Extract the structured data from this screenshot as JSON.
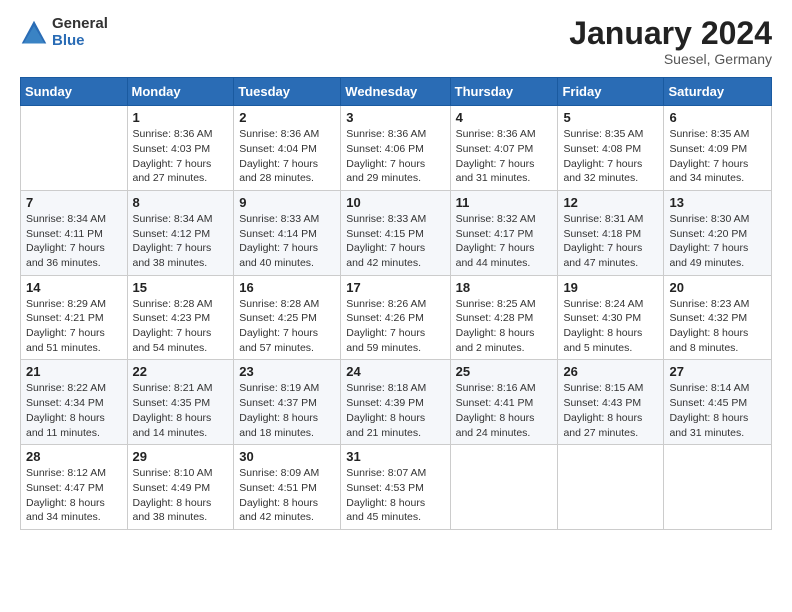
{
  "logo": {
    "general": "General",
    "blue": "Blue"
  },
  "header": {
    "month_title": "January 2024",
    "subtitle": "Suesel, Germany"
  },
  "weekdays": [
    "Sunday",
    "Monday",
    "Tuesday",
    "Wednesday",
    "Thursday",
    "Friday",
    "Saturday"
  ],
  "weeks": [
    [
      {
        "day": "",
        "info": ""
      },
      {
        "day": "1",
        "info": "Sunrise: 8:36 AM\nSunset: 4:03 PM\nDaylight: 7 hours\nand 27 minutes."
      },
      {
        "day": "2",
        "info": "Sunrise: 8:36 AM\nSunset: 4:04 PM\nDaylight: 7 hours\nand 28 minutes."
      },
      {
        "day": "3",
        "info": "Sunrise: 8:36 AM\nSunset: 4:06 PM\nDaylight: 7 hours\nand 29 minutes."
      },
      {
        "day": "4",
        "info": "Sunrise: 8:36 AM\nSunset: 4:07 PM\nDaylight: 7 hours\nand 31 minutes."
      },
      {
        "day": "5",
        "info": "Sunrise: 8:35 AM\nSunset: 4:08 PM\nDaylight: 7 hours\nand 32 minutes."
      },
      {
        "day": "6",
        "info": "Sunrise: 8:35 AM\nSunset: 4:09 PM\nDaylight: 7 hours\nand 34 minutes."
      }
    ],
    [
      {
        "day": "7",
        "info": "Sunrise: 8:34 AM\nSunset: 4:11 PM\nDaylight: 7 hours\nand 36 minutes."
      },
      {
        "day": "8",
        "info": "Sunrise: 8:34 AM\nSunset: 4:12 PM\nDaylight: 7 hours\nand 38 minutes."
      },
      {
        "day": "9",
        "info": "Sunrise: 8:33 AM\nSunset: 4:14 PM\nDaylight: 7 hours\nand 40 minutes."
      },
      {
        "day": "10",
        "info": "Sunrise: 8:33 AM\nSunset: 4:15 PM\nDaylight: 7 hours\nand 42 minutes."
      },
      {
        "day": "11",
        "info": "Sunrise: 8:32 AM\nSunset: 4:17 PM\nDaylight: 7 hours\nand 44 minutes."
      },
      {
        "day": "12",
        "info": "Sunrise: 8:31 AM\nSunset: 4:18 PM\nDaylight: 7 hours\nand 47 minutes."
      },
      {
        "day": "13",
        "info": "Sunrise: 8:30 AM\nSunset: 4:20 PM\nDaylight: 7 hours\nand 49 minutes."
      }
    ],
    [
      {
        "day": "14",
        "info": "Sunrise: 8:29 AM\nSunset: 4:21 PM\nDaylight: 7 hours\nand 51 minutes."
      },
      {
        "day": "15",
        "info": "Sunrise: 8:28 AM\nSunset: 4:23 PM\nDaylight: 7 hours\nand 54 minutes."
      },
      {
        "day": "16",
        "info": "Sunrise: 8:28 AM\nSunset: 4:25 PM\nDaylight: 7 hours\nand 57 minutes."
      },
      {
        "day": "17",
        "info": "Sunrise: 8:26 AM\nSunset: 4:26 PM\nDaylight: 7 hours\nand 59 minutes."
      },
      {
        "day": "18",
        "info": "Sunrise: 8:25 AM\nSunset: 4:28 PM\nDaylight: 8 hours\nand 2 minutes."
      },
      {
        "day": "19",
        "info": "Sunrise: 8:24 AM\nSunset: 4:30 PM\nDaylight: 8 hours\nand 5 minutes."
      },
      {
        "day": "20",
        "info": "Sunrise: 8:23 AM\nSunset: 4:32 PM\nDaylight: 8 hours\nand 8 minutes."
      }
    ],
    [
      {
        "day": "21",
        "info": "Sunrise: 8:22 AM\nSunset: 4:34 PM\nDaylight: 8 hours\nand 11 minutes."
      },
      {
        "day": "22",
        "info": "Sunrise: 8:21 AM\nSunset: 4:35 PM\nDaylight: 8 hours\nand 14 minutes."
      },
      {
        "day": "23",
        "info": "Sunrise: 8:19 AM\nSunset: 4:37 PM\nDaylight: 8 hours\nand 18 minutes."
      },
      {
        "day": "24",
        "info": "Sunrise: 8:18 AM\nSunset: 4:39 PM\nDaylight: 8 hours\nand 21 minutes."
      },
      {
        "day": "25",
        "info": "Sunrise: 8:16 AM\nSunset: 4:41 PM\nDaylight: 8 hours\nand 24 minutes."
      },
      {
        "day": "26",
        "info": "Sunrise: 8:15 AM\nSunset: 4:43 PM\nDaylight: 8 hours\nand 27 minutes."
      },
      {
        "day": "27",
        "info": "Sunrise: 8:14 AM\nSunset: 4:45 PM\nDaylight: 8 hours\nand 31 minutes."
      }
    ],
    [
      {
        "day": "28",
        "info": "Sunrise: 8:12 AM\nSunset: 4:47 PM\nDaylight: 8 hours\nand 34 minutes."
      },
      {
        "day": "29",
        "info": "Sunrise: 8:10 AM\nSunset: 4:49 PM\nDaylight: 8 hours\nand 38 minutes."
      },
      {
        "day": "30",
        "info": "Sunrise: 8:09 AM\nSunset: 4:51 PM\nDaylight: 8 hours\nand 42 minutes."
      },
      {
        "day": "31",
        "info": "Sunrise: 8:07 AM\nSunset: 4:53 PM\nDaylight: 8 hours\nand 45 minutes."
      },
      {
        "day": "",
        "info": ""
      },
      {
        "day": "",
        "info": ""
      },
      {
        "day": "",
        "info": ""
      }
    ]
  ]
}
